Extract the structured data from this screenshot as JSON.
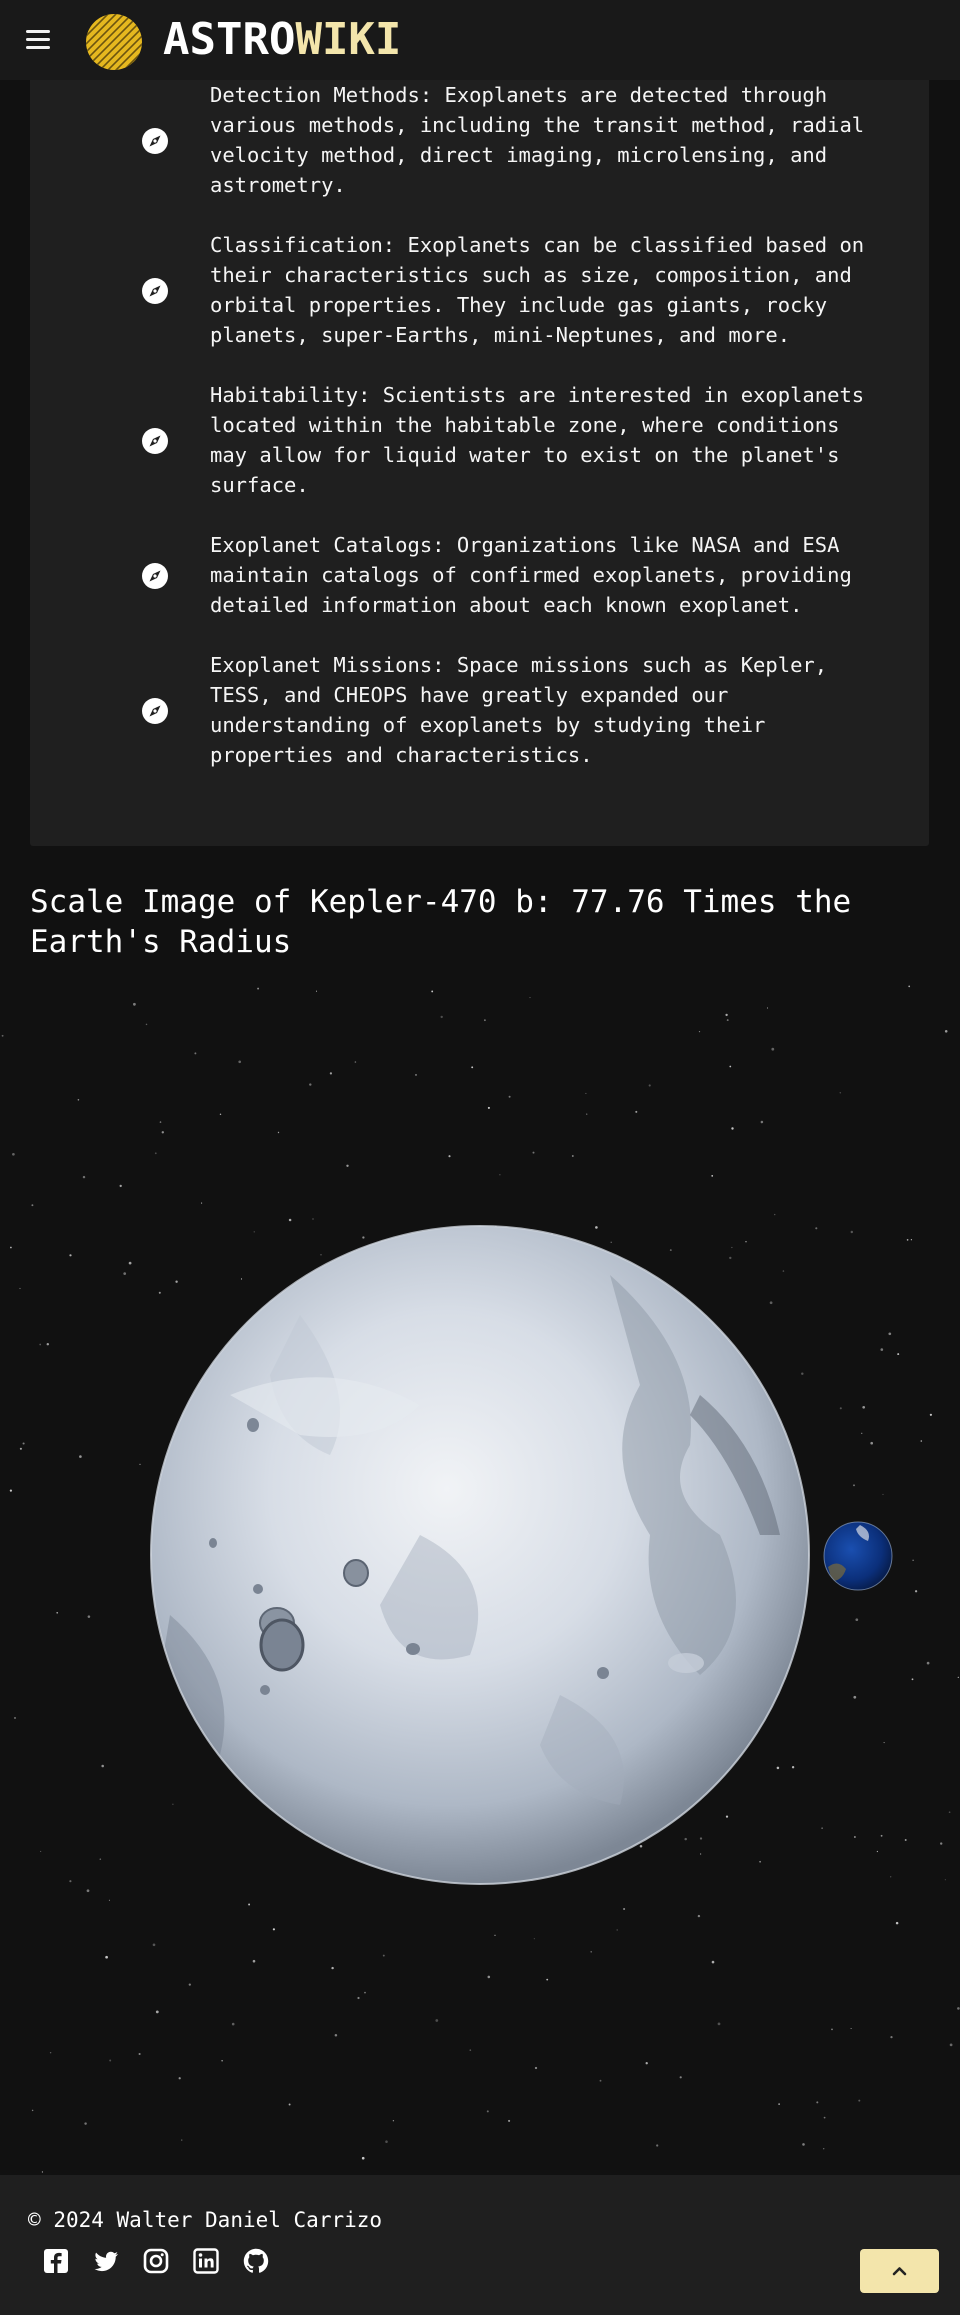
{
  "header": {
    "logo_part1": "ASTRO",
    "logo_part2": "WIKI",
    "menu_icon": "hamburger-menu-icon",
    "logo_icon": "striped-planet-logo",
    "accent_color": "#f3e5ab"
  },
  "facts": [
    {
      "icon": "compass-icon",
      "text": "Detection Methods: Exoplanets are detected through\nvarious methods, including the transit method, radial\nvelocity method, direct imaging, microlensing, and\nastrometry."
    },
    {
      "icon": "compass-icon",
      "text": "Classification: Exoplanets can be classified based on\ntheir characteristics such as size, composition, and\norbital properties. They include gas giants, rocky\nplanets, super-Earths, mini-Neptunes, and more."
    },
    {
      "icon": "compass-icon",
      "text": "Habitability: Scientists are interested in exoplanets\nlocated within the habitable zone, where conditions\nmay allow for liquid water to exist on the planet's\nsurface."
    },
    {
      "icon": "compass-icon",
      "text": "Exoplanet Catalogs: Organizations like NASA and ESA\nmaintain catalogs of confirmed exoplanets, providing\ndetailed information about each known exoplanet."
    },
    {
      "icon": "compass-icon",
      "text": "Exoplanet Missions: Space missions such as Kepler,\nTESS, and CHEOPS have greatly expanded our\nunderstanding of exoplanets by studying their\nproperties and characteristics."
    }
  ],
  "scale": {
    "title": "Scale Image of Kepler-470 b: 77.76 Times the\nEarth's Radius",
    "planet_icon": "icy-planet-kepler-470b",
    "earth_icon": "earth-icon"
  },
  "footer": {
    "copyright_symbol": "©",
    "copyright": "2024 Walter Daniel Carrizo",
    "socials": [
      "facebook-icon",
      "twitter-icon",
      "instagram-icon",
      "linkedin-icon",
      "github-icon"
    ],
    "top_button_icon": "chevron-up-icon"
  }
}
